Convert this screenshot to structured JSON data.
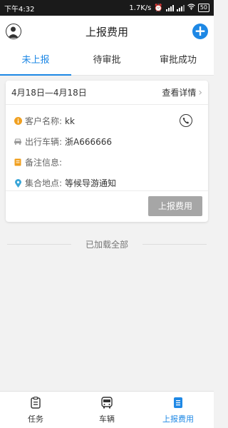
{
  "status": {
    "time": "下午4:32",
    "net_speed": "1.7K/s",
    "battery": "50"
  },
  "header": {
    "title": "上报费用"
  },
  "tabs": [
    {
      "label": "未上报",
      "active": true
    },
    {
      "label": "待审批",
      "active": false
    },
    {
      "label": "审批成功",
      "active": false
    }
  ],
  "card": {
    "date_range": "4月18日—4月18日",
    "detail_label": "查看详情",
    "rows": [
      {
        "icon": "info-icon",
        "label": "客户名称:",
        "value": "kk"
      },
      {
        "icon": "car-icon",
        "label": "出行车辆:",
        "value": "浙A666666"
      },
      {
        "icon": "bookmark-icon",
        "label": "备注信息:",
        "value": ""
      },
      {
        "icon": "location-pin-icon",
        "label": "集合地点:",
        "value": "等候导游通知"
      }
    ],
    "report_button": "上报费用"
  },
  "list_end_text": "已加载全部",
  "bottom_nav": [
    {
      "label": "任务",
      "icon": "clipboard-icon",
      "active": false
    },
    {
      "label": "车辆",
      "icon": "bus-icon",
      "active": false
    },
    {
      "label": "上报费用",
      "icon": "receipt-icon",
      "active": true
    }
  ],
  "colors": {
    "accent": "#1e88e5",
    "button_gray": "#a6a6a6",
    "statusbar": "#1a1a1a"
  }
}
